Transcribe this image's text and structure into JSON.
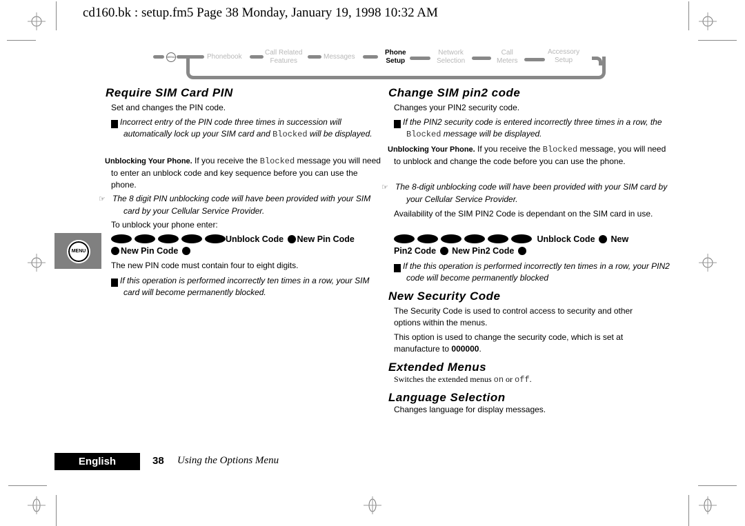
{
  "header": {
    "file_info": "cd160.bk : setup.fm5  Page 38  Monday, January 19, 1998  10:32 AM"
  },
  "menu_nav": {
    "menu_icon": "MENU",
    "items": [
      {
        "label_line1": "Phonebook",
        "label_line2": "",
        "active": false
      },
      {
        "label_line1": "Call Related",
        "label_line2": "Features",
        "active": false
      },
      {
        "label_line1": "Messages",
        "label_line2": "",
        "active": false
      },
      {
        "label_line1": "Phone",
        "label_line2": "Setup",
        "active": true
      },
      {
        "label_line1": "Network",
        "label_line2": "Selection",
        "active": false
      },
      {
        "label_line1": "Call",
        "label_line2": "Meters",
        "active": false
      },
      {
        "label_line1": "Accessory",
        "label_line2": "Setup",
        "active": false
      }
    ]
  },
  "left_column": {
    "require_pin": {
      "title": "Require SIM Card PIN",
      "intro": "Set and changes the PIN code.",
      "warning_pre": "Incorrect entry of the PIN code three times in succession will automatically lock up your SIM card and ",
      "warning_code": "Blocked",
      "warning_post": " will be displayed.",
      "unblock_lead": "Unblocking Your Phone.",
      "unblock_pre": " If you receive the ",
      "unblock_code": "Blocked",
      "unblock_post": " message you will need to enter an unblock code and key sequence before you can use the phone.",
      "note": "The 8 digit PIN unblocking code will have been provided with your SIM card by your Cellular Service Provider.",
      "to_unblock": "To unblock your phone enter:",
      "sequence_keys": 5,
      "seq_unblock": "Unblock Code",
      "seq_new_pin": "New Pin Code",
      "seq_new_pin_repeat": "New Pin Code",
      "pin_length": "The new PIN code must contain four to eight digits.",
      "warning2": "If this operation is performed incorrectly ten times in a row, your SIM card will become permanently blocked."
    },
    "menu_tab_label": "MENU"
  },
  "right_column": {
    "change_pin2": {
      "title": "Change SIM pin2 code",
      "intro": "Changes your PIN2 security code.",
      "warning_pre": "If the PIN2 security code is entered incorrectly three times in a row, the ",
      "warning_code": "Blocked",
      "warning_post": " message will be displayed.",
      "unblock_lead": "Unblocking Your Phone.",
      "unblock_pre": " If you receive the ",
      "unblock_code": "Blocked",
      "unblock_post": "  message, you will need to unblock and change the code before you can use the phone.",
      "note": "The 8-digit unblocking code will have been provided with your SIM card by your Cellular Service Provider.",
      "availability": "Availability of the SIM PIN2 Code is dependant on the SIM card in use.",
      "sequence_keys": 6,
      "seq_unblock": "Unblock Code",
      "seq_new": "New",
      "seq_pin2": "Pin2 Code",
      "seq_new_pin2": "New Pin2 Code",
      "warning2": "If the this operation is performed incorrectly ten times in a row, your PIN2 code will become permanently blocked"
    },
    "security_code": {
      "title": "New Security Code",
      "p1": "The Security Code is used to control access to security and other options within the menus.",
      "p2_pre": "This option is used to change the security code, which is set at manufacture to ",
      "p2_code": "000000",
      "p2_post": "."
    },
    "extended_menus": {
      "title": "Extended Menus",
      "pre": "Switches the extended menus ",
      "on": "on",
      "mid": " or ",
      "off": "off",
      "post": "."
    },
    "language": {
      "title": "Language Selection",
      "text": "Changes language for display messages."
    }
  },
  "footer": {
    "language_tab": "English",
    "page_number": "38",
    "section_title": "Using the Options Menu"
  }
}
